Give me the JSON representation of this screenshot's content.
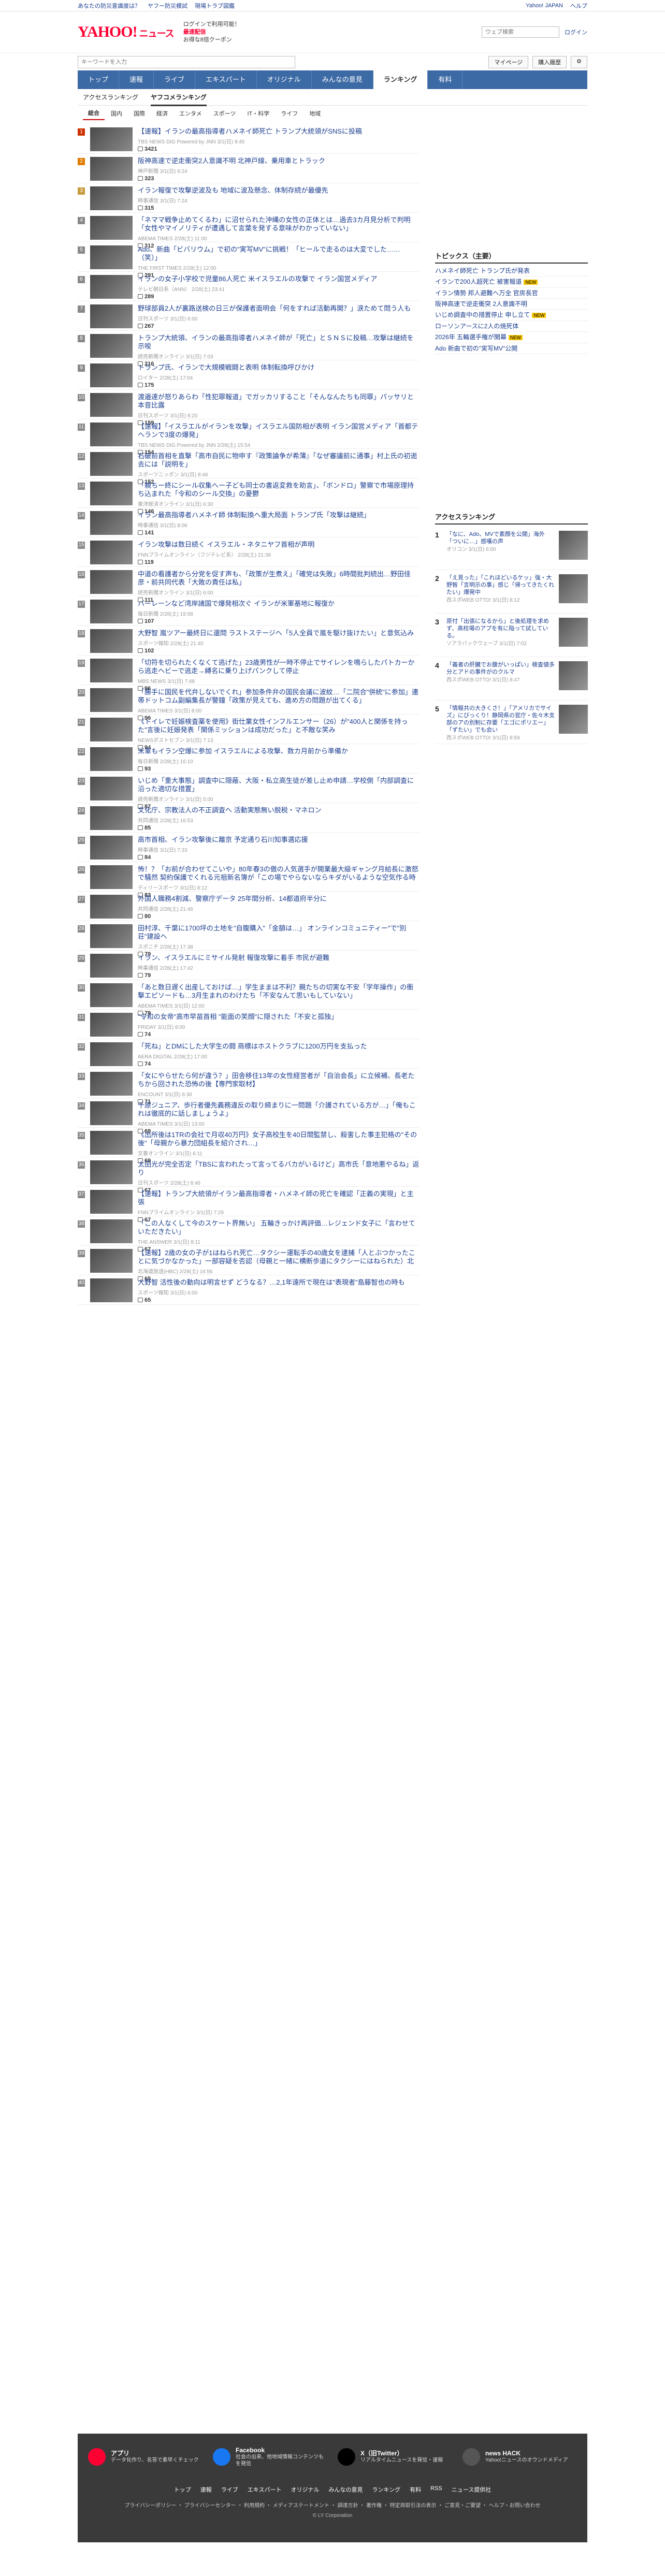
{
  "topbar": {
    "links": [
      "あなたの防災意識度は？",
      "ヤフー防災模試",
      "現場トラブ図鑑",
      "Yahoo! JAPAN",
      "ヘルプ"
    ]
  },
  "header": {
    "logo": "YAHOO!",
    "logo_sub": "ニュース",
    "promo_line1": "ログインで利用可能！",
    "promo_line2": "最速配信",
    "promo_line3": "お得な8倍クーポン",
    "search_placeholder": "ウェブ検索",
    "user": "ログイン"
  },
  "search": {
    "placeholder": "キーワードを入力",
    "mypage": "マイページ",
    "buy": "購入履歴"
  },
  "gnav": [
    "トップ",
    "速報",
    "ライブ",
    "エキスパート",
    "オリジナル",
    "みんなの意見",
    "ランキング",
    "有料"
  ],
  "gnav_active": 6,
  "subnav": [
    "アクセスランキング",
    "ヤフコメランキング"
  ],
  "catnav": [
    "総合",
    "国内",
    "国際",
    "経済",
    "エンタメ",
    "スポーツ",
    "IT・科学",
    "ライフ",
    "地域"
  ],
  "items": [
    {
      "rank": "1",
      "title": "【速報】イランの最高指導者ハメネイ師死亡 トランプ大統領がSNSに投稿",
      "src": "TBS NEWS DIG Powered by JNN 3/1(日) 9:45",
      "cmt": "3421"
    },
    {
      "rank": "2",
      "title": "阪神高速で逆走衝突2人意識不明 北神戸線、乗用車とトラック",
      "src": "神戸新聞 3/1(日) 6:24",
      "cmt": "323"
    },
    {
      "rank": "3",
      "title": "イラン報復で攻撃逆波及も 地域に波及懸念、体制存続が最優先",
      "src": "時事通信 3/1(日) 7:24",
      "cmt": "315"
    },
    {
      "rank": "4",
      "title": "「ネママ戦争止めてくるわ」に沼せられた沖縄の女性の正体とは…過去3カ月見分析で判明「女性やマイノリティが遭遇して言葉を発する意味がわかっていない」",
      "src": "ABEMA TIMES 2/28(土) 11:00",
      "cmt": "312"
    },
    {
      "rank": "5",
      "title": "Ado、新曲「ビバリウム」で初の\"実写MV\"に挑戦！「ヒールで走るのは大変でした……（笑）」",
      "src": "THE FIRST TIMES 2/28(土) 12:00",
      "cmt": "291"
    },
    {
      "rank": "6",
      "title": "イランの女子小学校で児童86人死亡 米イスラエルの攻撃で イラン国営メディア",
      "src": "テレビ朝日系（ANN） 2/28(土) 23:41",
      "cmt": "289"
    },
    {
      "rank": "7",
      "title": "野球部員2人が裏路送検の日三が保護者面明会「何をすれば活動再開？」涙ためて問う人も",
      "src": "日刊スポーツ 3/1(日) 6:00",
      "cmt": "267"
    },
    {
      "rank": "8",
      "title": "トランプ大統領、イランの最高指導者ハメネイ師が「死亡」とＳＮＳに投稿…攻撃は継続を示唆",
      "src": "読売新聞オンライン 3/1(日) 7:03",
      "cmt": "216"
    },
    {
      "rank": "9",
      "title": "トランプ氏、イランで大規模戦闘と表明 体制転換呼びかけ",
      "src": "ロイター 2/28(土) 17:04",
      "cmt": "175"
    },
    {
      "rank": "10",
      "title": "渡邉達が怒りあらわ「性犯罪報道」でガッカリすること「そんなんたちも同罪」パッサリと本音比露",
      "src": "日刊スポーツ 3/1(日) 8:20",
      "cmt": "159"
    },
    {
      "rank": "11",
      "title": "【速報】「イスラエルがイランを攻撃」イスラエル国防相が表明 イラン国営メディア「首都テヘランで3度の爆発」",
      "src": "TBS NEWS DIG Powered by JNN 2/28(土) 15:54",
      "cmt": "154"
    },
    {
      "rank": "12",
      "title": "石破前首相を直撃「高市自民に物申す『政策論争が希薄』「なぜ審議前に通事」村上氏の初逝去には「説明を」",
      "src": "スポーツニッポン 3/1(日) 8:46",
      "cmt": "152"
    },
    {
      "rank": "13",
      "title": "「親ちー終にシール収集へー子ども同士の書返変救を助言」、「ボンドロ」警察で市場原理持ち込まれた「令和のシール交換」の憂鬱",
      "src": "東洋経済オンライン 3/1(日) 6:30",
      "cmt": "146"
    },
    {
      "rank": "14",
      "title": "イラン最高指導者ハメネイ師 体制転換へ重大局面 トランプ氏「攻撃は継続」",
      "src": "時事通信 3/1(日) 8:06",
      "cmt": "141"
    },
    {
      "rank": "15",
      "title": "イラン攻撃は数日続く イスラエル・ネタニヤフ首相が声明",
      "src": "FNNプライムオンライン（フジテレビ系） 2/28(土) 21:38",
      "cmt": "119"
    },
    {
      "rank": "16",
      "title": "中道の看護者から分党を促す声も、「政策が生煮え」「確党は失敗」6時間批判続出…野田佳彦・前共同代表「大敗の責任は私」",
      "src": "読売新聞オンライン 3/1(日) 6:00",
      "cmt": "111"
    },
    {
      "rank": "17",
      "title": "バーレーンなど湾岸諸国で爆発相次ぐ イランが米軍基地に報復か",
      "src": "毎日新聞 2/28(土) 19:58",
      "cmt": "107"
    },
    {
      "rank": "18",
      "title": "大野智 嵐ツアー最終日に還問 ラストステージへ「5人全員で嵐を駆け抜けたい」と意気込み",
      "src": "スポーツ報知 2/28(土) 21:40",
      "cmt": "102"
    },
    {
      "rank": "19",
      "title": "「切符を切られたくなくて逃げた」23歳男性が一時不停止でサイレンを鳴らしたパトカーから逃走ヘビーで逃走→縛名に乗り上げパンクして停止",
      "src": "MBS NEWS 3/1(日) 7:48",
      "cmt": "96"
    },
    {
      "rank": "20",
      "title": "「勝手に国民を代弁しないでくれ」参加条件弁の国民会議に波紋…「二院合\"併統\"に参加」連帯ドットコム副編集長が警鐘「政策が見えても、進め方の問題が出てくる」",
      "src": "ABEMA TIMES 3/1(日) 8:00",
      "cmt": "96"
    },
    {
      "rank": "21",
      "title": "《トイレで妊娠検査薬を使用》街仕業女性インフルエンサー（26）が\"400人と関係を持った\"言後に妊娠発表「関係ミッションは成功だった」と不敵な笑み",
      "src": "NEWSポストセブン 3/1(日) 7:13",
      "cmt": "94"
    },
    {
      "rank": "22",
      "title": "米軍もイラン空爆に参加 イスラエルによる攻撃、数カ月前から準備か",
      "src": "毎日新聞 2/28(土) 16:10",
      "cmt": "93"
    },
    {
      "rank": "23",
      "title": "いじめ「重大事態」調査中に隠蔽、大阪・私立高生徒が差し止め申請…学校側「内部調査に沿った適切な措置」",
      "src": "読売新聞オンライン 3/1(日) 5:00",
      "cmt": "87"
    },
    {
      "rank": "24",
      "title": "文化庁、宗教法人の不正調査へ 活動実態無い脱税・マネロン",
      "src": "共同通信 2/28(土) 16:53",
      "cmt": "85"
    },
    {
      "rank": "25",
      "title": "高市首相、イラン攻撃後に離京 予定通り石川知事選応援",
      "src": "時事通信 3/1(日) 7:33",
      "cmt": "84"
    },
    {
      "rank": "26",
      "title": "怖！？「お前が合わせてこいや」80年春3の傲の人気選手が開業最大級ギャング月給長に激怒で騒然 契約保護でくれる元祖新名簿が「この場でやらないならキダがいるような空気作る時恋心でどうにもかない」",
      "src": "ディリースポーツ 3/1(日) 8:12",
      "cmt": "83"
    },
    {
      "rank": "27",
      "title": "外国人職務4割減、警察庁データ 25年間分析、14都道府半分に",
      "src": "共同通信 2/28(土) 21:46",
      "cmt": "80"
    },
    {
      "rank": "28",
      "title": "田村淳、千葉に1700坪の土地を\"自腹購入\"「金額は…」 オンラインコミュニティー\"で\"別荘\"建設へ",
      "src": "スポニチ 2/28(土) 17:38",
      "cmt": "79"
    },
    {
      "rank": "29",
      "title": "イラン、イスラエルにミサイル発射 報復攻撃に着手 市民が避難",
      "src": "時事通信 2/28(土) 17:42",
      "cmt": "79"
    },
    {
      "rank": "30",
      "title": "「あと数日遅く出産しておけば…」学生ままは不利？親たちの切実な不安「学年操作」の衝撃エピソードも…3月生まれのわけたち「不安なんて思いもしていない」",
      "src": "ABEMA TIMES 3/1(日) 12:00",
      "cmt": "79"
    },
    {
      "rank": "31",
      "title": "\"令和の女帝\"高市早苗首相 \"能面の笑顔\"に隠された「不安と孤独」",
      "src": "FRIDAY 3/1(日) 8:00",
      "cmt": "74"
    },
    {
      "rank": "32",
      "title": "「死ね」とDMにした大学生の闘 商標はホストクラブに1200万円を支払った",
      "src": "AERA DIGITAL 2/28(土) 17:00",
      "cmt": "74"
    },
    {
      "rank": "33",
      "title": "「女にやらせたら何が違う？」田舎移住13年の女性経営者が「自治会長」に立候補、長老たちから回された恐怖の後【専門家取材】",
      "src": "ENCOUNT 3/1(日) 6:30",
      "cmt": "71"
    },
    {
      "rank": "34",
      "title": "千原ジュニア、歩行者優先義務違反の取り締まりに一問題「介護されている方が…」「俺もこれは徹底的に話しましょうよ」",
      "src": "ABEMA TIMES 3/1(日) 13:00",
      "cmt": "69"
    },
    {
      "rank": "35",
      "title": "《出所後は1TRの会社で月収40万円》女子高校生を40日間監禁し、殺害した事主犯格の\"その後\"「母親から暴力団組長を紹介され…」",
      "src": "文春オンライン 3/1(日) 6:11",
      "cmt": "69"
    },
    {
      "rank": "36",
      "title": "太田光が完全否定「TBSに言われたって言ってるバカがいるけど」高市氏「意地悪やるね」返り",
      "src": "日刊スポーツ 2/28(土) 8:46",
      "cmt": "67"
    },
    {
      "rank": "37",
      "title": "【速報】トランプ大統領がイラン最高指導者・ハメネイ師の死亡を確認「正義の実現」と主張",
      "src": "FNNプライムオンライン 3/1(日) 7:29",
      "cmt": "67"
    },
    {
      "rank": "38",
      "title": "「この人なくして今のスケート界無い」 五輪きっかけ再評価…レジェンド女子に「言わせていただきたい」",
      "src": "THE ANSWER 3/1(日) 8:11",
      "cmt": "67"
    },
    {
      "rank": "39",
      "title": "【速報】2歳の女の子が1はねられ死亡…タクシー運転手の40歳女を逮捕「人とぶつかったことに気づかなかった」一部容疑を否認（母親と一緒に横断歩道にタクシーにはねられた）北海道旭川市",
      "src": "北海道放送(HBC) 2/28(土) 16:56",
      "cmt": "65"
    },
    {
      "rank": "40",
      "title": "大野智 活性後の動向は明言せず どうなる？…2,1年遠所で現在は\"表現者\"島藤智也の時も",
      "src": "スポーツ報知 3/1(日) 6:00",
      "cmt": "65"
    }
  ],
  "topics": {
    "heading": "トピックス（主要）",
    "items": [
      {
        "t": "ハメネイ師死亡 トランプ氏が発表",
        "new": false
      },
      {
        "t": "イランで200人超死亡 被害報道",
        "new": true
      },
      {
        "t": "イラン情勢 邦人避難へ万全 官房長官",
        "new": false
      },
      {
        "t": "阪神高速で逆走衝突 2人意識不明",
        "new": false
      },
      {
        "t": "いじめ調査中の措置停止 申し立て",
        "new": true
      },
      {
        "t": "ローソンアースに2人の焼死体",
        "new": false
      },
      {
        "t": "2026年 五輪選手権が開幕",
        "new": true
      },
      {
        "t": "Ado 新曲で初の\"実写MV\"公開",
        "new": false
      }
    ],
    "new_label": "NEW"
  },
  "access": {
    "heading": "アクセスランキング",
    "items": [
      {
        "n": "1",
        "t": "「なに、Ado、MVで素顔を公開」海外「ついに…」感嘆の声",
        "s": "オリコン 3/1(日) 6:00"
      },
      {
        "n": "2",
        "t": "「え見った」「これほどいるケッ」強・大野智「言明示の事」感じ「帰ってきたくれたい」爆発中",
        "s": "西スポWEB OTTO! 3/1(日) 8:12"
      },
      {
        "n": "3",
        "t": "原付「出張になるから」と後処理を求めず、高校場のアプを有に陥って試している。",
        "s": "ソアラバックウェーブ 3/1(日) 7:02"
      },
      {
        "n": "4",
        "t": "「義者の肝臓でお腹がいっぱい」検査値多分とアドの事件がのクルマ",
        "s": "西スポWEB OTTO! 3/1(日) 8:47"
      },
      {
        "n": "5",
        "t": "「情報共の大きくさ！」「アメリカでサイズ」にびっくり！静岡県の官庁・佐々木支部のアの別制に存要「エゴにポリエー」「ずたい」でも会い",
        "s": "西スポWEB OTTO! 3/1(日) 8:59"
      }
    ]
  },
  "footer": {
    "apps": [
      {
        "name": "アプリ",
        "desc": "データ化作り、名答で素早くチェック"
      },
      {
        "name": "Facebook",
        "desc": "社会の出来、他地域情報コンテンツもを発信"
      },
      {
        "name": "X（旧Twitter）",
        "desc": "リアルタイムニュースを発信・速報"
      },
      {
        "name": "news HACK",
        "desc": "Yahoo!ニュースのオウンドメディア"
      }
    ],
    "nav": [
      "トップ",
      "速報",
      "ライブ",
      "エキスパート",
      "オリジナル",
      "みんなの意見",
      "ランキング",
      "有料",
      "RSS",
      "ニュース提供社"
    ],
    "links": "プライバシーポリシー ・ プライバシーセンター ・ 利用規約 ・ メディアステートメント ・ 調達方針 ・ 著作権 ・ 特定商取引法の表示 ・ ご意見・ご要望 ・ ヘルプ・お問い合わせ",
    "copy": "© LY Corporation"
  }
}
